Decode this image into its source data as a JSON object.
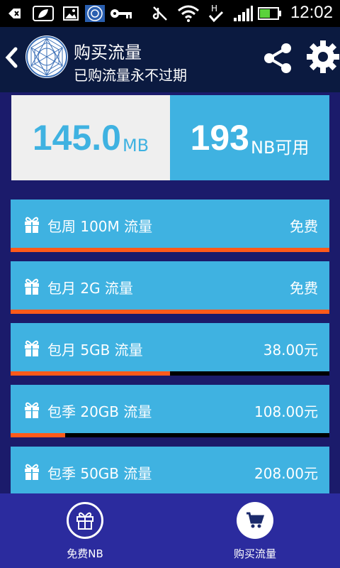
{
  "status_bar": {
    "time": "12:02"
  },
  "header": {
    "title": "购买流量",
    "subtitle": "已购流量永不过期"
  },
  "summary": {
    "data_value": "145.0",
    "data_unit": "MB",
    "nb_value": "193",
    "nb_unit": "NB可用"
  },
  "packages": [
    {
      "name": "包周 100M 流量",
      "price": "免费",
      "progress": 1.0
    },
    {
      "name": "包月 2G 流量",
      "price": "免费",
      "progress": 1.0
    },
    {
      "name": "包月 5GB 流量",
      "price": "38.00元",
      "progress": 0.5
    },
    {
      "name": "包季 20GB 流量",
      "price": "108.00元",
      "progress": 0.17
    },
    {
      "name": "包季 50GB 流量",
      "price": "208.00元",
      "progress": 0.0
    }
  ],
  "bottom_nav": {
    "free_nb_label": "免费NB",
    "buy_data_label": "购买流量"
  },
  "colors": {
    "accent": "#3fb2e1",
    "progress": "#ff5a1a",
    "header_bg": "#0b1a40",
    "nav_bg": "#2b2b9e"
  }
}
